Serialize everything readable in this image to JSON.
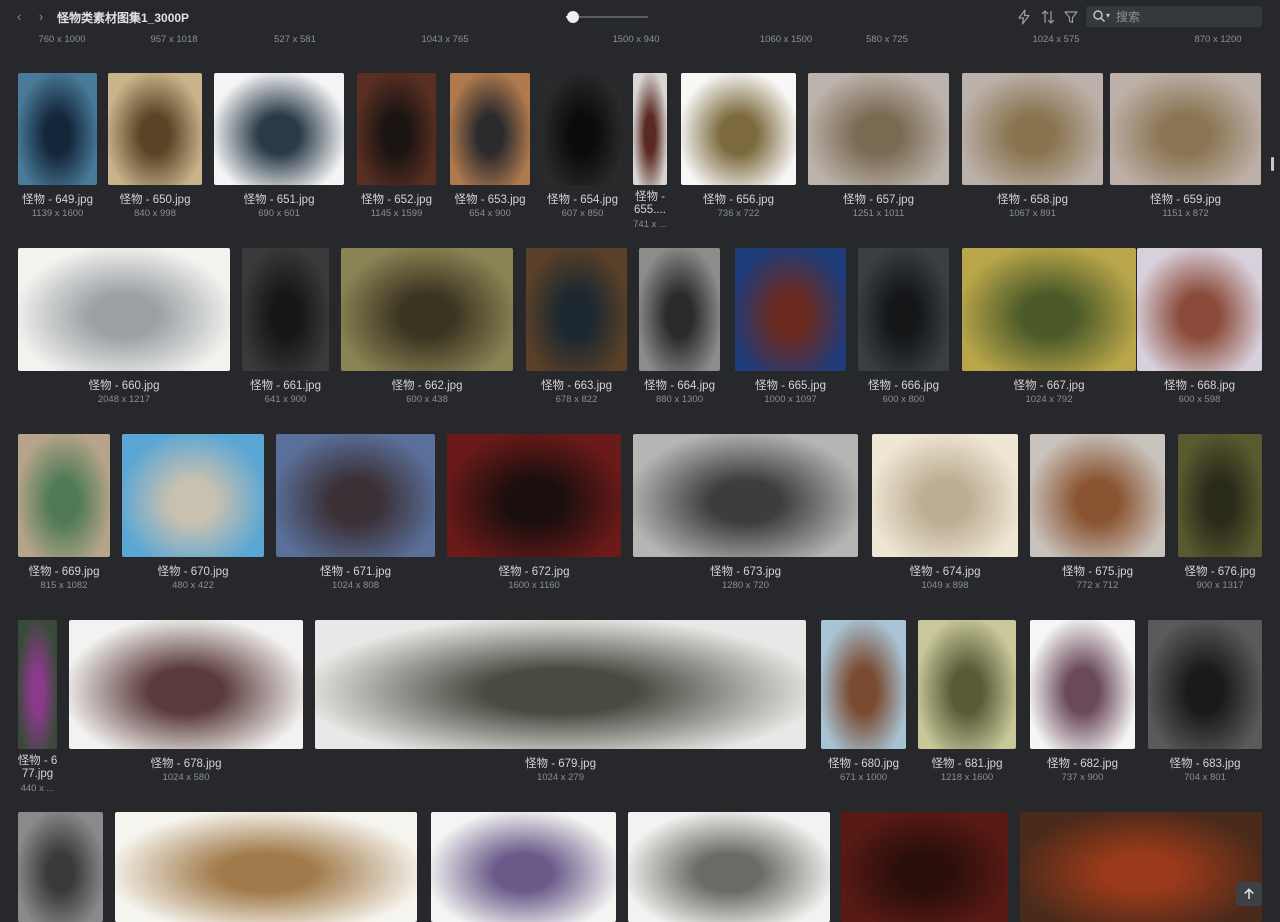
{
  "window": {
    "title": "怪物类素材图集1_3000P"
  },
  "nav": {
    "back_glyph": "‹",
    "forward_glyph": "›"
  },
  "zoom_slider": {
    "value_percent": 8
  },
  "toolbar_icons": [
    "flash-icon",
    "sort-icon",
    "filter-icon"
  ],
  "search": {
    "placeholder": "搜索",
    "value": ""
  },
  "top_row_sizes": [
    "760 x 1000",
    "957 x 1018",
    "527 x 581",
    "1043 x 765",
    "1500 x 940",
    "1060 x 1500",
    "580 x 725",
    "1024 x 575",
    "870 x 1200"
  ],
  "rows": [
    {
      "items": [
        {
          "name": "怪物 - 649.jpg",
          "size": "1139 x 1600",
          "colors": [
            "#4a7a99",
            "#13263a"
          ]
        },
        {
          "name": "怪物 - 650.jpg",
          "size": "840 x 998",
          "colors": [
            "#c9b38a",
            "#5b4326"
          ]
        },
        {
          "name": "怪物 - 651.jpg",
          "size": "690 x 601",
          "colors": [
            "#f4f4f4",
            "#2a3a48"
          ]
        },
        {
          "name": "怪物 - 652.jpg",
          "size": "1145 x 1599",
          "colors": [
            "#5a2f22",
            "#1a1412"
          ]
        },
        {
          "name": "怪物 - 653.jpg",
          "size": "654 x 900",
          "colors": [
            "#b07a4e",
            "#2b2a2c"
          ]
        },
        {
          "name": "怪物 - 654.jpg",
          "size": "607 x 850",
          "colors": [
            "#2a2a2a",
            "#0b0b0b"
          ]
        },
        {
          "name": "怪物 - 655....",
          "size": "741 x ...",
          "colors": [
            "#d8d5d2",
            "#5a2a22"
          ]
        },
        {
          "name": "怪物 - 656.jpg",
          "size": "736 x 722",
          "colors": [
            "#f7f7f5",
            "#7c6a3e"
          ]
        },
        {
          "name": "怪物 - 657.jpg",
          "size": "1251 x 1011",
          "colors": [
            "#bcb3ad",
            "#7a6a52"
          ]
        },
        {
          "name": "怪物 - 658.jpg",
          "size": "1067 x 891",
          "colors": [
            "#bcb1aa",
            "#8a7450"
          ]
        },
        {
          "name": "怪物 - 659.jpg",
          "size": "1151 x 872",
          "colors": [
            "#bdb0a8",
            "#8a7452"
          ]
        }
      ]
    },
    {
      "items": [
        {
          "name": "怪物 - 660.jpg",
          "size": "2048 x 1217",
          "colors": [
            "#f4f3f0",
            "#9aa0a4"
          ]
        },
        {
          "name": "怪物 - 661.jpg",
          "size": "641 x 900",
          "colors": [
            "#3a3a3a",
            "#161616"
          ]
        },
        {
          "name": "怪物 - 662.jpg",
          "size": "600 x 438",
          "colors": [
            "#8a8354",
            "#3b3421"
          ]
        },
        {
          "name": "怪物 - 663.jpg",
          "size": "678 x 822",
          "colors": [
            "#5a4028",
            "#1c2730"
          ]
        },
        {
          "name": "怪物 - 664.jpg",
          "size": "880 x 1300",
          "colors": [
            "#8c8c8a",
            "#2a2a2a"
          ]
        },
        {
          "name": "怪物 - 665.jpg",
          "size": "1000 x 1097",
          "colors": [
            "#1f3c7a",
            "#6a2a20"
          ]
        },
        {
          "name": "怪物 - 666.jpg",
          "size": "600 x 800",
          "colors": [
            "#3a3f44",
            "#141618"
          ]
        },
        {
          "name": "怪物 - 667.jpg",
          "size": "1024 x 792",
          "colors": [
            "#b9a64a",
            "#4b5a28"
          ]
        },
        {
          "name": "怪物 - 668.jpg",
          "size": "600 x 598",
          "colors": [
            "#d8d0da",
            "#8a4a3a"
          ]
        }
      ]
    },
    {
      "items": [
        {
          "name": "怪物 - 669.jpg",
          "size": "815 x 1082",
          "colors": [
            "#b7a58b",
            "#4f7a55"
          ]
        },
        {
          "name": "怪物 - 670.jpg",
          "size": "480 x 422",
          "colors": [
            "#5aa6d4",
            "#c9c1b0"
          ]
        },
        {
          "name": "怪物 - 671.jpg",
          "size": "1024 x 808",
          "colors": [
            "#5a6f99",
            "#3a3036"
          ]
        },
        {
          "name": "怪物 - 672.jpg",
          "size": "1600 x 1160",
          "colors": [
            "#6a1a18",
            "#1a0e0e"
          ]
        },
        {
          "name": "怪物 - 673.jpg",
          "size": "1280 x 720",
          "colors": [
            "#b5b5b3",
            "#3c3d3f"
          ]
        },
        {
          "name": "怪物 - 674.jpg",
          "size": "1049 x 898",
          "colors": [
            "#efe6d4",
            "#bcae93"
          ]
        },
        {
          "name": "怪物 - 675.jpg",
          "size": "772 x 712",
          "colors": [
            "#c9c3bd",
            "#8a5432"
          ]
        },
        {
          "name": "怪物 - 676.jpg",
          "size": "900 x 1317",
          "colors": [
            "#5a5a30",
            "#2a2a1a"
          ]
        }
      ]
    },
    {
      "items": [
        {
          "name": "怪物 - 677.jpg",
          "size": "440 x ...",
          "colors": [
            "#3a4a3a",
            "#8a3a8a"
          ]
        },
        {
          "name": "怪物 - 678.jpg",
          "size": "1024 x 580",
          "colors": [
            "#f2f2f0",
            "#5a3a3a"
          ]
        },
        {
          "name": "怪物 - 679.jpg",
          "size": "1024 x 279",
          "colors": [
            "#e8e8e6",
            "#4a4a42"
          ]
        },
        {
          "name": "怪物 - 680.jpg",
          "size": "671 x 1000",
          "colors": [
            "#a8c4d4",
            "#7a4a32"
          ]
        },
        {
          "name": "怪物 - 681.jpg",
          "size": "1218 x 1600",
          "colors": [
            "#c8c89a",
            "#5a5a38"
          ]
        },
        {
          "name": "怪物 - 682.jpg",
          "size": "737 x 900",
          "colors": [
            "#f6f6f6",
            "#6a4a5a"
          ]
        },
        {
          "name": "怪物 - 683.jpg",
          "size": "704 x 801",
          "colors": [
            "#5a5a5a",
            "#1a1a1a"
          ]
        }
      ]
    },
    {
      "items": [
        {
          "name": "",
          "size": "",
          "colors": [
            "#8a8a8a",
            "#3a3a3a"
          ]
        },
        {
          "name": "",
          "size": "",
          "colors": [
            "#f6f4ee",
            "#a07a4a"
          ]
        },
        {
          "name": "",
          "size": "",
          "colors": [
            "#f4f4f2",
            "#6a5a8a"
          ]
        },
        {
          "name": "",
          "size": "",
          "colors": [
            "#f2f2f0",
            "#6a6a66"
          ]
        },
        {
          "name": "",
          "size": "",
          "colors": [
            "#5a1a14",
            "#2a0e0c"
          ]
        },
        {
          "name": "",
          "size": "",
          "colors": [
            "#4a2a1a",
            "#9a3a1a"
          ]
        }
      ]
    }
  ],
  "back_to_top": {
    "icon": "arrow-up-icon"
  }
}
